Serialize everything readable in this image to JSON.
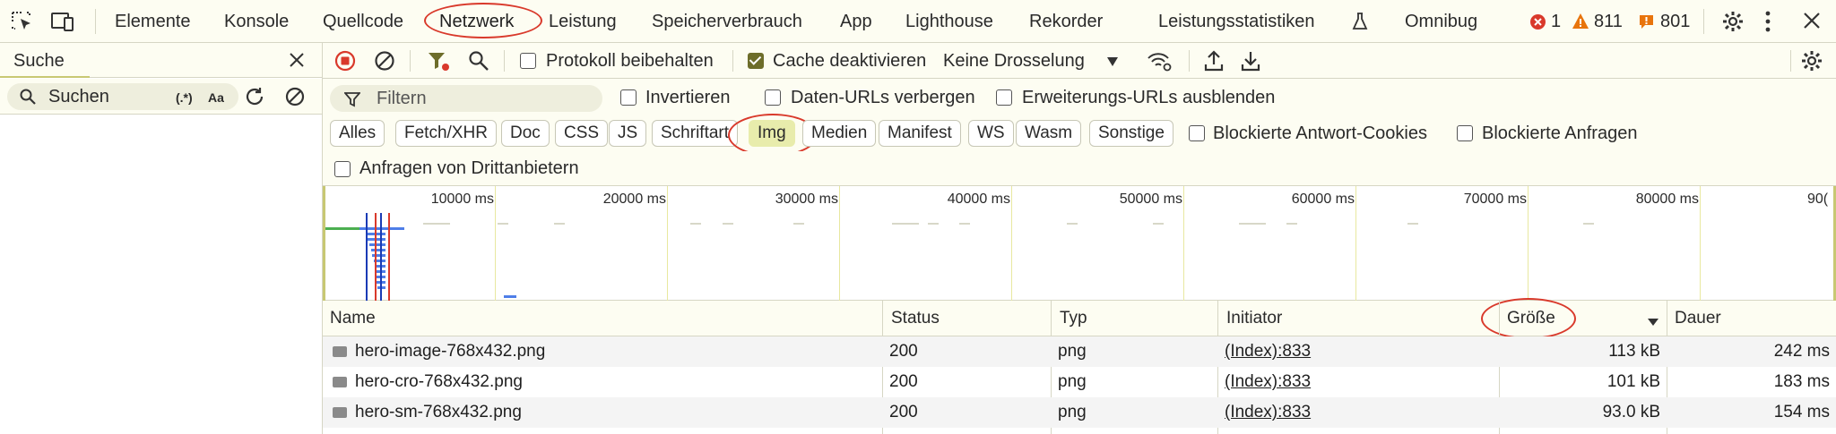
{
  "tabs": [
    {
      "label": "Elemente"
    },
    {
      "label": "Konsole"
    },
    {
      "label": "Quellcode"
    },
    {
      "label": "Netzwerk"
    },
    {
      "label": "Leistung"
    },
    {
      "label": "Speicherverbrauch"
    },
    {
      "label": "App"
    },
    {
      "label": "Lighthouse"
    },
    {
      "label": "Rekorder"
    },
    {
      "label": "Leistungsstatistiken"
    },
    {
      "label": "Omnibug"
    }
  ],
  "issues": {
    "errors": "1",
    "warnings": "811",
    "info": "801"
  },
  "search_panel": {
    "title": "Suche",
    "placeholder": "Suchen",
    "regex_label": "(.*)",
    "case_label": "Aa"
  },
  "toolbar": {
    "preserve_log": {
      "label": "Protokoll beibehalten",
      "checked": false
    },
    "disable_cache": {
      "label": "Cache deaktivieren",
      "checked": true
    },
    "throttling": "Keine Drosselung"
  },
  "filter": {
    "placeholder": "Filtern",
    "invert": {
      "label": "Invertieren",
      "checked": false
    },
    "hide_data_urls": {
      "label": "Daten-URLs verbergen",
      "checked": false
    },
    "hide_extension_urls": {
      "label": "Erweiterungs-URLs ausblenden",
      "checked": false
    }
  },
  "type_filters": [
    {
      "label": "Alles",
      "active": false
    },
    {
      "label": "Fetch/XHR",
      "active": false
    },
    {
      "label": "Doc",
      "active": false
    },
    {
      "label": "CSS",
      "active": false
    },
    {
      "label": "JS",
      "active": false
    },
    {
      "label": "Schriftart",
      "active": false
    },
    {
      "label": "Img",
      "active": true
    },
    {
      "label": "Medien",
      "active": false
    },
    {
      "label": "Manifest",
      "active": false
    },
    {
      "label": "WS",
      "active": false
    },
    {
      "label": "Wasm",
      "active": false
    },
    {
      "label": "Sonstige",
      "active": false
    }
  ],
  "blocked_cookies": {
    "label": "Blockierte Antwort-Cookies",
    "checked": false
  },
  "blocked_requests": {
    "label": "Blockierte Anfragen",
    "checked": false
  },
  "third_party": {
    "label": "Anfragen von Drittanbietern",
    "checked": false
  },
  "overview": {
    "tick_labels": [
      "10000 ms",
      "20000 ms",
      "30000 ms",
      "40000 ms",
      "50000 ms",
      "60000 ms",
      "70000 ms",
      "80000 ms",
      "90("
    ]
  },
  "table": {
    "columns": [
      "Name",
      "Status",
      "Typ",
      "Initiator",
      "Größe",
      "Dauer"
    ],
    "sort_column": "Größe",
    "sort_direction": "descending",
    "rows": [
      {
        "name": "hero-image-768x432.png",
        "status": "200",
        "type": "png",
        "initiator": "(Index):833",
        "size": "113 kB",
        "duration": "242 ms"
      },
      {
        "name": "hero-cro-768x432.png",
        "status": "200",
        "type": "png",
        "initiator": "(Index):833",
        "size": "101 kB",
        "duration": "183 ms"
      },
      {
        "name": "hero-sm-768x432.png",
        "status": "200",
        "type": "png",
        "initiator": "(Index):833",
        "size": "93.0 kB",
        "duration": "154 ms"
      }
    ]
  },
  "colors": {
    "accent": "#6d6d2a",
    "error": "#d9392b",
    "warning": "#e8740c",
    "highlight": "#e8ecac"
  }
}
